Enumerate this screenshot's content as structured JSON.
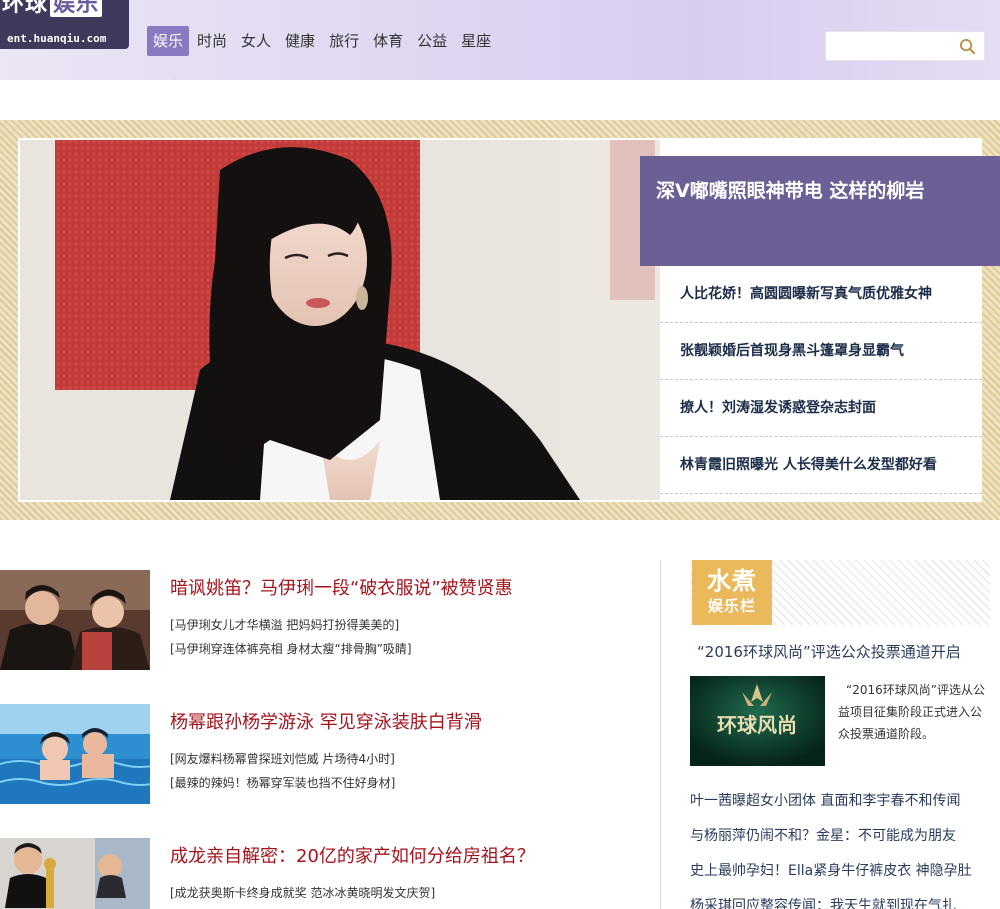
{
  "header": {
    "logo_main": "环球",
    "logo_tag": "娱乐",
    "logo_url": "ent.huanqiu.com",
    "nav": [
      "娱乐",
      "时尚",
      "女人",
      "健康",
      "旅行",
      "体育",
      "公益",
      "星座"
    ],
    "active_nav_index": 0,
    "search_value": "",
    "search_placeholder": ""
  },
  "banner": {
    "headline": "深V嘟嘴照眼神带电 这样的柳岩",
    "side_items": [
      "人比花娇！高圆圆曝新写真气质优雅女神",
      "张靓颖婚后首现身黑斗篷罩身显霸气",
      "撩人！刘涛湿发诱惑登杂志封面",
      "林青霞旧照曝光 人长得美什么发型都好看"
    ]
  },
  "news": [
    {
      "title": "暗讽姚笛？马伊琍一段“破衣服说”被赞贤惠",
      "subs": [
        "[马伊琍女儿才华横溢 把妈妈打扮得美美的]",
        "[马伊琍穿连体裤亮相 身材太瘦“排骨胸”吸睛]"
      ]
    },
    {
      "title": "杨幂跟孙杨学游泳 罕见穿泳装肤白背滑",
      "subs": [
        "[网友爆料杨幂曾探班刘恺威 片场待4小时]",
        "[最辣的辣妈！杨幂穿军装也挡不住好身材]"
      ]
    },
    {
      "title": "成龙亲自解密：20亿的家产如何分给房祖名？",
      "subs": [
        "[成龙获奥斯卡终身成就奖 范冰冰黄晓明发文庆贺]"
      ]
    }
  ],
  "column": {
    "badge_line1": "水煮",
    "badge_line2": "娱乐栏",
    "feature_title": "“2016环球风尚”评选公众投票通道开启",
    "feature_img_text": "环球风尚",
    "feature_desc": "“2016环球风尚”评选从公益项目征集阶段正式进入公众投票通道阶段。",
    "links": [
      "叶一茜曝超女小团体 直面和李宇春不和传闻",
      "与杨丽萍仍闹不和？金星：不可能成为朋友",
      "史上最帅孕妇！Ella紧身牛仔裤皮衣 神隐孕肚",
      "杨采琪回应整容传闻：我天生就到现在气扎"
    ]
  },
  "colors": {
    "nav_active": "#8a78c0",
    "headline_bg": "#6c5f95",
    "news_title": "#a4141c",
    "badge_bg": "#e9b95c",
    "link_text": "#2a3c5e"
  }
}
